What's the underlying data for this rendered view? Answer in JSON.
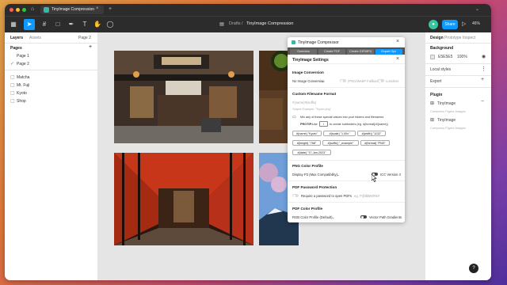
{
  "titlebar": {
    "tab_title": "TinyImage Compression"
  },
  "toolbar": {
    "breadcrumb_folder": "Drafts",
    "breadcrumb_sep": "/",
    "file_name": "TinyImage Compression",
    "share_label": "Share",
    "zoom": "46%"
  },
  "left": {
    "tabs": [
      "Layers",
      "Assets"
    ],
    "page_selector": "Page 2",
    "pages_heading": "Pages",
    "pages": [
      "Page 1",
      "Page 2"
    ],
    "layers": [
      "Matcha",
      "Mt. Fuji",
      "Kyoto",
      "Shop"
    ]
  },
  "right": {
    "tabs": [
      "Design",
      "Prototype",
      "Inspect"
    ],
    "background_heading": "Background",
    "bg_hex": "E5E5E5",
    "bg_opacity": "100%",
    "local_styles": "Local styles",
    "export": "Export",
    "plugin_heading": "Plugin",
    "plugin_name": "TinyImage",
    "plugin_sub": "Compress Figma Images"
  },
  "plugin": {
    "title": "TinyImage Compressor",
    "tabs": [
      "Overview",
      "Create PDF",
      "Create GIF/MP4",
      "Export Opt."
    ],
    "settings_title": "TinyImage Settings",
    "image_conversion": "Image Conversion",
    "no_conversion": "No Image Conversion",
    "png_fallback": "(PNG/WebP Fallback)",
    "lossless": "Lossless",
    "filename_heading": "Custom Filename Format",
    "filename_placeholder": "#{name}#{suffix}",
    "output_example": "Output Example: \"Kyoto.png\"",
    "mix_text": "Mix any of these special values into your folders and filenames",
    "protip_label": "PROTIP:",
    "protip_use": "Use",
    "protip_slash": "/",
    "protip_rest": "to create subfolders (eg. #{format}/#{name})",
    "chips": [
      "#{name} \"Kyoto\"",
      "#{scale} \"1.00x\"",
      "#{width} \"1132\"",
      "#{height} \"768\"",
      "#{suffix} \"_example\"",
      "#{format} \"PNG\"",
      "#{date} \"17-Jan-2023\""
    ],
    "png_heading": "PNG Color Profile",
    "png_profile": "Display P3 (Max Compatibility)",
    "icc": "ICC Version 4",
    "pdf_pw_heading": "PDF Password Protection",
    "pdf_pw_text": "Require a password to open PDFs",
    "pdf_pw_placeholder": "eg. P@$$W0RD!",
    "pdf_color_heading": "PDF Color Profile",
    "pdf_color": "RGB Color Profile (Default)",
    "vector_text": "Vector Path Gradients"
  },
  "colors": {
    "accent": "#0d99ff",
    "toolbar": "#2c2c2c",
    "canvas": "#e5e5e5"
  }
}
